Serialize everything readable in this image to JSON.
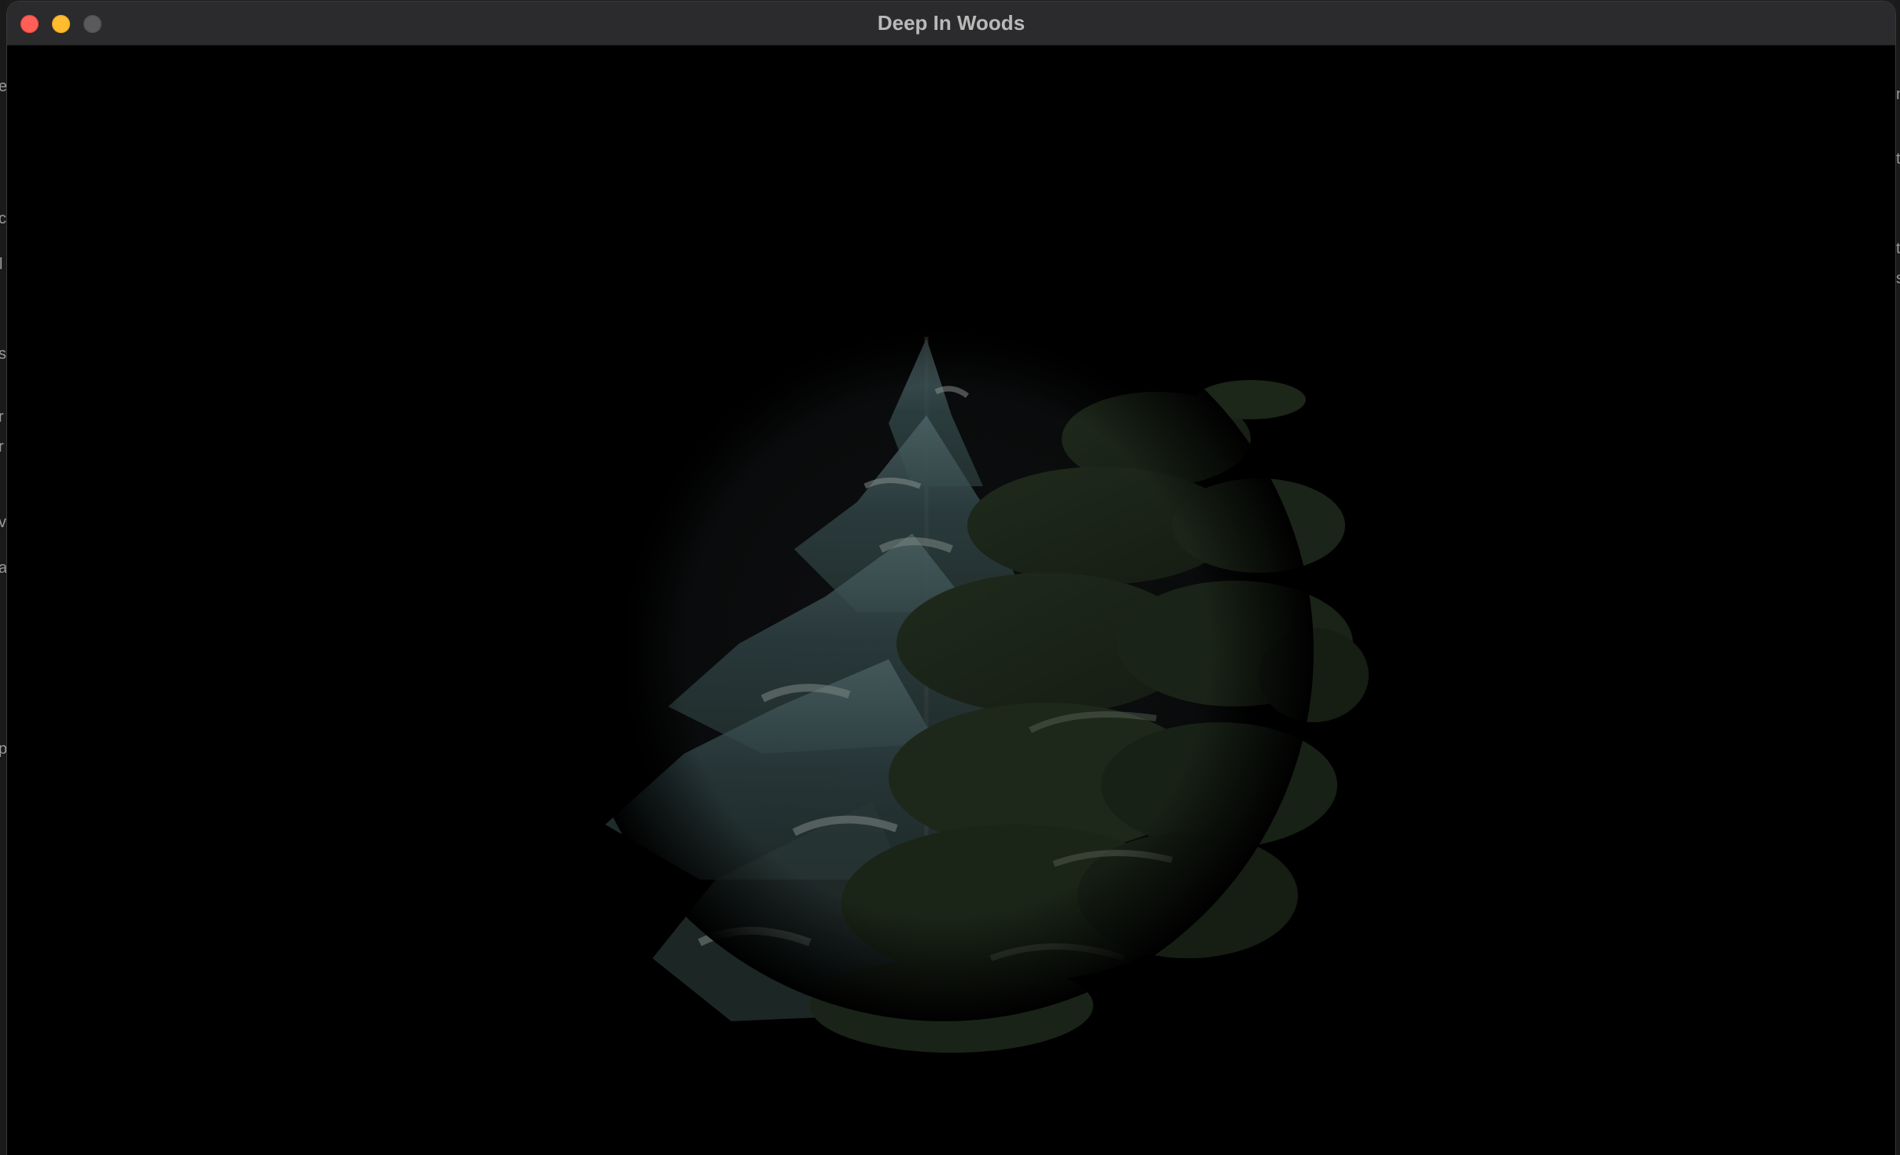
{
  "window": {
    "title": "Deep In Woods"
  },
  "desktop_edge": {
    "left_glyphs": [
      "e",
      "c",
      "l",
      "s",
      "r",
      "r",
      "v",
      "a",
      "p"
    ],
    "right_glyphs": [
      "n",
      "t",
      "t",
      "s"
    ]
  },
  "colors": {
    "close": "#ff5f57",
    "minimize": "#febc2e",
    "zoom": "#5a5a5c",
    "background": "#000000"
  },
  "scene": {
    "subject": "evergreen trees in a dim circular spotlight"
  }
}
